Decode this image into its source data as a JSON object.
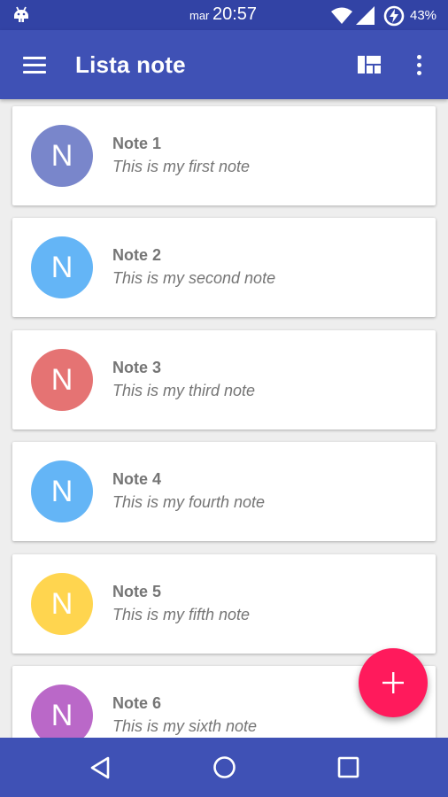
{
  "status_bar": {
    "day": "mar",
    "time": "20:57",
    "battery_percent": "43%",
    "icons": [
      "android-debug-icon",
      "wifi-icon",
      "signal-icon",
      "battery-charging-icon"
    ]
  },
  "app_bar": {
    "title": "Lista note",
    "icons": [
      "menu-icon",
      "layout-icon",
      "overflow-menu-icon"
    ]
  },
  "notes": [
    {
      "initial": "N",
      "title": "Note 1",
      "body": "This is my first note",
      "color": "#7986cb"
    },
    {
      "initial": "N",
      "title": "Note 2",
      "body": "This is my second note",
      "color": "#64b5f6"
    },
    {
      "initial": "N",
      "title": "Note 3",
      "body": "This is my third note",
      "color": "#e57373"
    },
    {
      "initial": "N",
      "title": "Note 4",
      "body": "This is my fourth note",
      "color": "#64b5f6"
    },
    {
      "initial": "N",
      "title": "Note 5",
      "body": "This is my fifth note",
      "color": "#ffd54f"
    },
    {
      "initial": "N",
      "title": "Note 6",
      "body": "This is my sixth note",
      "color": "#ba68c8"
    }
  ],
  "fab": {
    "icon": "add-icon",
    "color": "#ff1a5c"
  },
  "nav_bar": {
    "icons": [
      "back-icon",
      "home-icon",
      "recents-icon"
    ]
  },
  "colors": {
    "primary": "#3f51b5",
    "primary_dark": "#3243a5",
    "background": "#eeeeee",
    "text_secondary": "#757575"
  }
}
